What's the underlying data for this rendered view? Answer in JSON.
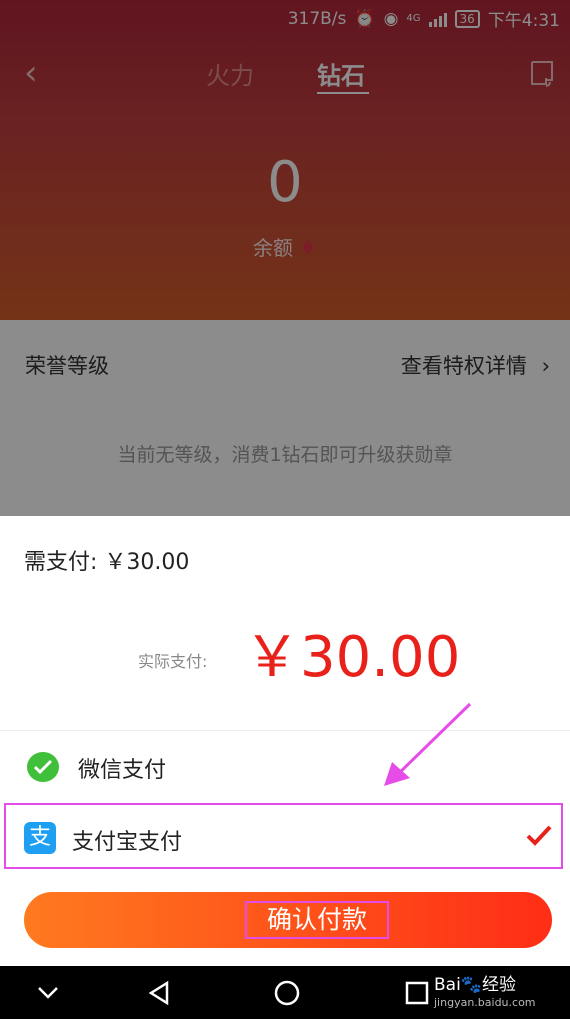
{
  "status_bar": {
    "speed": "317B/s",
    "network": "4G",
    "battery": "36",
    "time": "下午4:31"
  },
  "header": {
    "tabs": [
      {
        "label": "火力"
      },
      {
        "label": "钻石"
      }
    ],
    "active_tab": "钻石"
  },
  "balance": {
    "amount": "0",
    "label": "余额"
  },
  "honor": {
    "title": "荣誉等级",
    "link": "查看特权详情",
    "description": "当前无等级，消费1钻石即可升级获勋章"
  },
  "payment": {
    "need_pay": "需支付: ￥30.00",
    "actual_label": "实际支付:",
    "actual_amount": "￥30.00",
    "methods": [
      {
        "label": "微信支付",
        "icon": "wechat-icon",
        "selected": false
      },
      {
        "label": "支付宝支付",
        "icon": "alipay-icon",
        "icon_text": "支",
        "selected": true
      }
    ],
    "confirm_label": "确认付款"
  },
  "watermark": {
    "brand": "Bai🐾经验",
    "url": "jingyan.baidu.com"
  },
  "colors": {
    "accent_red": "#e8221b",
    "highlight": "#e64ce7",
    "button_start": "#ff7a1f",
    "button_end": "#ff2d16"
  }
}
